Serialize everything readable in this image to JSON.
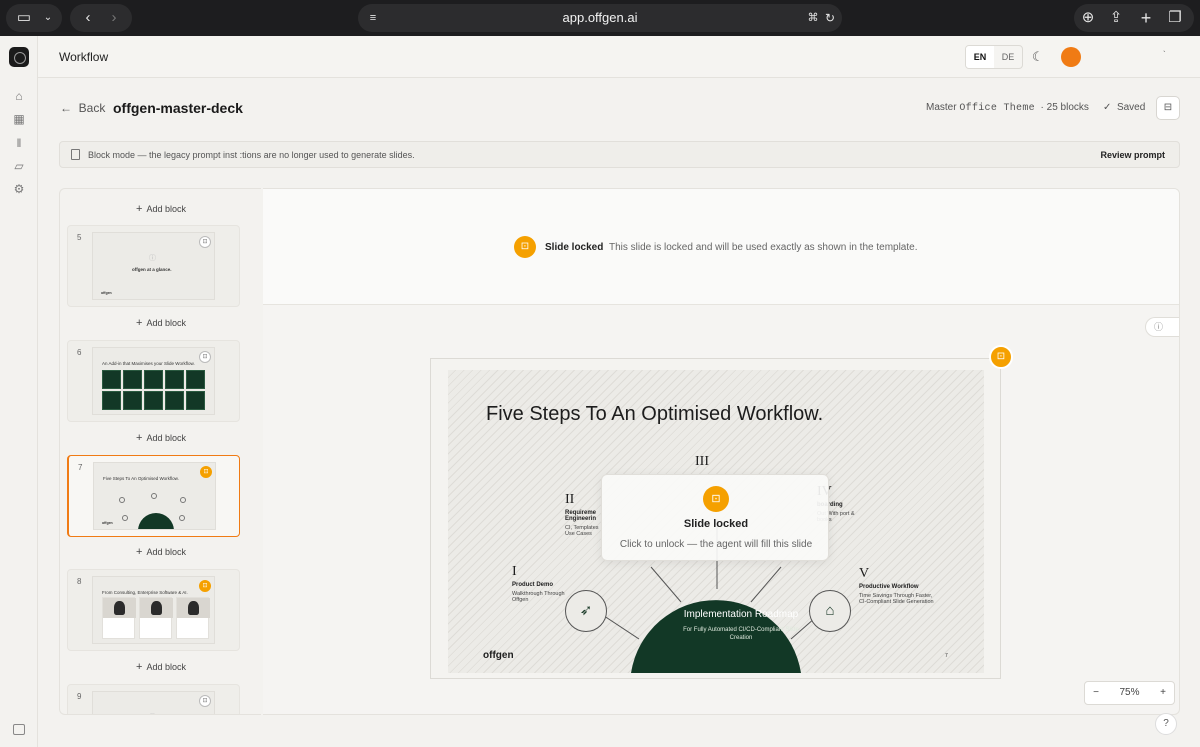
{
  "browser": {
    "url": "app.offgen.ai"
  },
  "header": {
    "title": "Workflow",
    "lang_en": "EN",
    "lang_de": "DE",
    "tick": "`"
  },
  "doc": {
    "back_label": "Back",
    "title": "offgen-master-deck",
    "theme_prefix": "Master ",
    "theme_mono": "Office Theme",
    "blocks": "· 25 blocks",
    "saved": "Saved"
  },
  "banner": {
    "text": "Block mode — the legacy prompt inst    :tions are no longer used to generate slides.",
    "action": "Review prompt"
  },
  "panel": {
    "add_block": "Add block",
    "slides": [
      {
        "num": "5",
        "title": "offgen at a glance.",
        "locked": false
      },
      {
        "num": "6",
        "title": "An Add-in that Maximises your Slide Workflow.",
        "locked": false
      },
      {
        "num": "7",
        "title": "Five Steps To An Optimised Workflow.",
        "locked": true
      },
      {
        "num": "8",
        "title": "From Consulting, Enterprise Software & AI.",
        "locked": true
      },
      {
        "num": "9",
        "title": "",
        "locked": false
      }
    ],
    "brand": "offgen"
  },
  "lockbar": {
    "title": "Slide locked",
    "desc": "This slide is locked and will be used exactly as shown in the template."
  },
  "slide": {
    "title": "Five Steps To An Optimised Workflow.",
    "brand": "offgen",
    "page": "7",
    "center_title": "Implementation Roadmap",
    "center_sub": "For Fully Automated CI/CD-Compliant Slide Creation",
    "steps": [
      {
        "num": "I",
        "head": "Product Demo",
        "desc": "Walkthrough Through Offgen"
      },
      {
        "num": "II",
        "head": "Requireme Engineerin",
        "desc": "CI, Templates Use Cases"
      },
      {
        "num": "III",
        "head": "",
        "desc": ""
      },
      {
        "num": "IV",
        "head": "boarding",
        "desc": "Out With port & books"
      },
      {
        "num": "V",
        "head": "Productive Workflow",
        "desc": "Time Savings Through Faster, CI-Compliant Slide Generation"
      }
    ]
  },
  "overlay": {
    "title": "Slide locked",
    "desc": "Click to unlock — the agent will fill this slide"
  },
  "zoom": {
    "minus": "−",
    "value": "75%",
    "plus": "+"
  },
  "colors": {
    "accent": "#f07b14",
    "lock": "#f5a000",
    "dome": "#123826"
  }
}
